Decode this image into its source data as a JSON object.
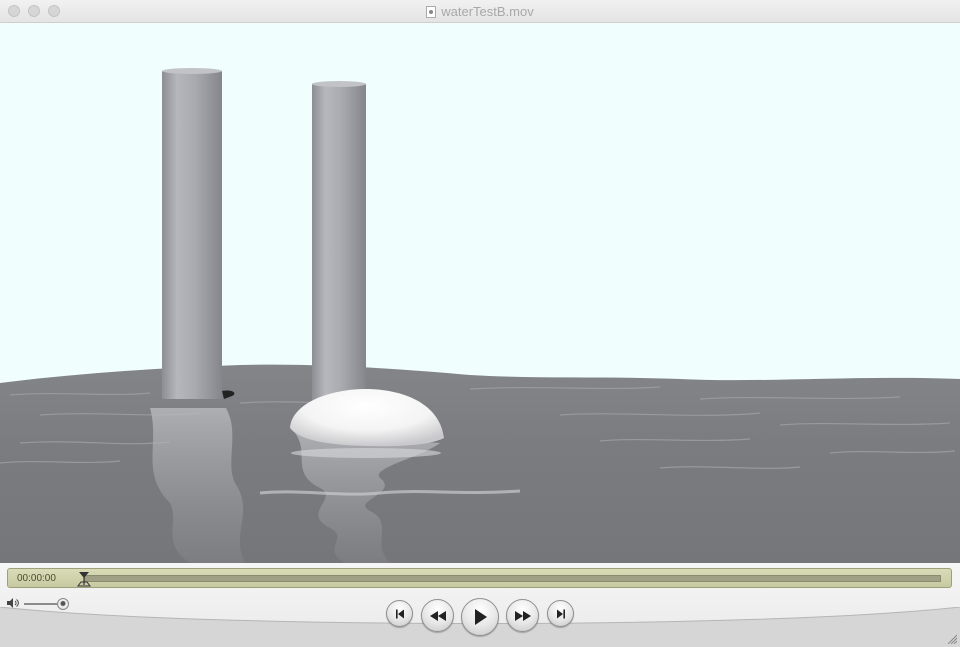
{
  "window": {
    "title": "waterTestB.mov"
  },
  "player": {
    "timecode": "00:00:00",
    "progress": 0.0,
    "volume": 1.0
  },
  "controls": {
    "icons": [
      "skip-to-start-icon",
      "rewind-icon",
      "play-icon",
      "fast-forward-icon",
      "skip-to-end-icon",
      "volume-icon"
    ]
  },
  "colors": {
    "sky": "#f0fefe",
    "water": "#7a7b80",
    "scrubber": "#cdd0aa"
  }
}
